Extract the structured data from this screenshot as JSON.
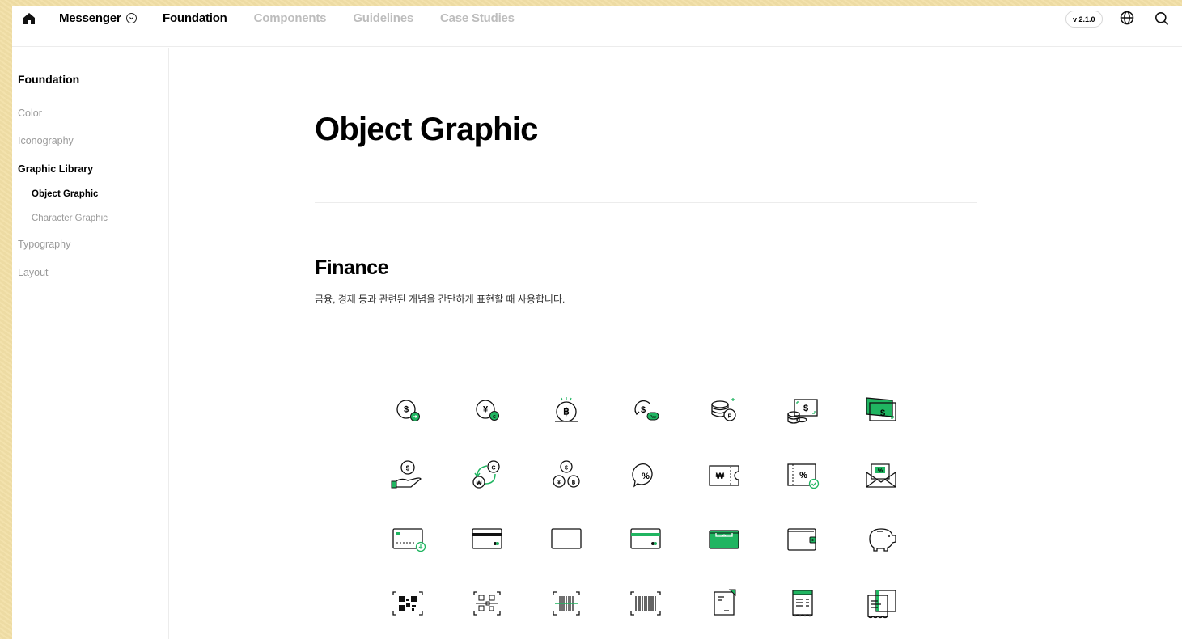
{
  "header": {
    "brand": "Messenger",
    "nav": [
      "Foundation",
      "Components",
      "Guidelines",
      "Case Studies"
    ],
    "active_nav": "Foundation",
    "version": "v 2.1.0"
  },
  "sidebar": {
    "title": "Foundation",
    "items": [
      {
        "label": "Color"
      },
      {
        "label": "Iconography"
      },
      {
        "label": "Graphic Library"
      },
      {
        "label": "Typography"
      },
      {
        "label": "Layout"
      }
    ],
    "sub_items": [
      {
        "label": "Object Graphic"
      },
      {
        "label": "Character Graphic"
      }
    ]
  },
  "main": {
    "title": "Object Graphic",
    "section": {
      "title": "Finance",
      "description": "금융, 경제 등과 관련된 개념을 간단하게 표현할 때 사용합니다."
    }
  },
  "colors": {
    "accent": "#20b561",
    "text": "#000000",
    "muted": "#9a9a9a"
  },
  "icons": [
    [
      "dollar-coin-send-icon",
      "yen-coin-icon",
      "baht-coin-icon",
      "dollar-pay-icon",
      "coin-stack-point-icon",
      "cash-coins-icon",
      "cash-bills-icon"
    ],
    [
      "dollar-hand-icon",
      "currency-exchange-icon",
      "multi-currency-coins-icon",
      "percent-chat-icon",
      "won-ticket-icon",
      "percent-coupon-check-icon",
      "percent-envelope-icon"
    ],
    [
      "card-download-icon",
      "card-black-stripe-icon",
      "card-green-icon",
      "card-green-stripe-icon",
      "wallet-green-icon",
      "wallet-icon",
      "piggy-bank-icon"
    ],
    [
      "qr-code-icon",
      "qr-code-scan-icon",
      "barcode-scan-icon",
      "barcode-icon",
      "receipt-icon",
      "receipt-list-icon",
      "receipts-stack-icon"
    ]
  ]
}
